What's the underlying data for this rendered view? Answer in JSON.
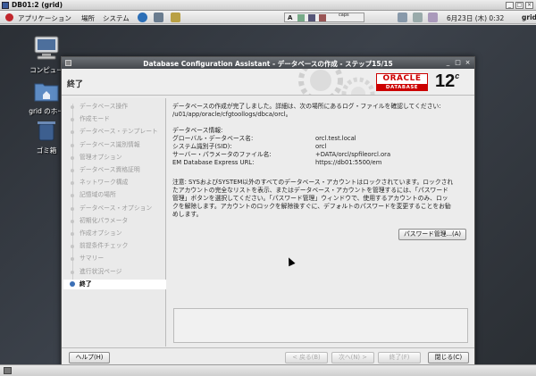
{
  "vnc": {
    "title": "DB01:2 (grid)"
  },
  "panel": {
    "menus": [
      "アプリケーション",
      "場所",
      "システム"
    ],
    "caps": "caps",
    "datetime": "6月23日 (木)  0:32",
    "user": "grid"
  },
  "desktop": {
    "icons": [
      "コンピュー",
      "grid のホー",
      "ゴミ箱"
    ]
  },
  "dialog": {
    "title": "Database Configuration Assistant - データベースの作成 - ステップ15/15",
    "step_title": "終了",
    "logo_top": "ORACLE",
    "logo_bottom": "DATABASE",
    "version": "12",
    "version_sup": "c",
    "nav": [
      {
        "label": "データベース操作",
        "active": false
      },
      {
        "label": "作成モード",
        "active": false
      },
      {
        "label": "データベース・テンプレート",
        "active": false
      },
      {
        "label": "データベース識別情報",
        "active": false
      },
      {
        "label": "管理オプション",
        "active": false
      },
      {
        "label": "データベース資格証明",
        "active": false
      },
      {
        "label": "ネットワーク構成",
        "active": false
      },
      {
        "label": "記憶域の場所",
        "active": false
      },
      {
        "label": "データベース・オプション",
        "active": false
      },
      {
        "label": "初期化パラメータ",
        "active": false
      },
      {
        "label": "作成オプション",
        "active": false
      },
      {
        "label": "前提条件チェック",
        "active": false
      },
      {
        "label": "サマリー",
        "active": false
      },
      {
        "label": "進行状況ページ",
        "active": false
      },
      {
        "label": "終了",
        "active": true
      }
    ],
    "main": {
      "intro_line1": "データベースの作成が完了しました。詳細は、次の場所にあるログ・ファイルを確認してください:",
      "intro_line2": "/u01/app/oracle/cfgtoollogs/dbca/orcl。",
      "info_heading": "データベース情報:",
      "info": [
        {
          "k": "グローバル・データベース名:",
          "v": "orcl.test.local"
        },
        {
          "k": "システム識別子(SID):",
          "v": "orcl"
        },
        {
          "k": "サーバー・パラメータのファイル名:",
          "v": "+DATA/orcl/spfileorcl.ora"
        },
        {
          "k": "EM Database Express URL:",
          "v": "https://db01:5500/em"
        }
      ],
      "note_lines": [
        "注意: SYSおよびSYSTEM以外のすべてのデータベース・アカウントはロックされています。ロックされ",
        "たアカウントの完全なリストを表示、またはデータベース・アカウントを管理するには、「パスワード",
        "管理」ボタンを選択してください。「パスワード管理」ウィンドウで、使用するアカウントのみ、ロッ",
        "クを解除します。アカウントのロックを解除後すぐに、デフォルトのパスワードを変更することをお勧",
        "めします。"
      ],
      "password_button": "パスワード管理...(A)"
    },
    "footer": {
      "help": "ヘルプ(H)",
      "back": "< 戻る(B)",
      "next": "次へ(N) >",
      "finish": "終了(F)",
      "close": "閉じる(C)"
    }
  }
}
